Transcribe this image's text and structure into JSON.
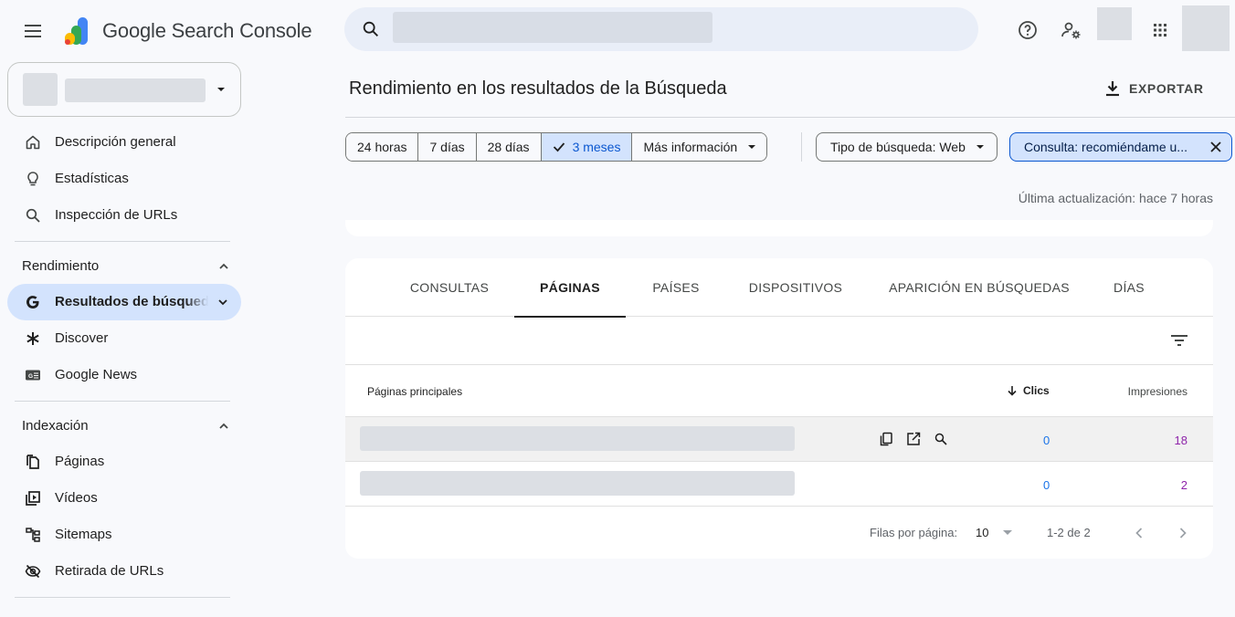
{
  "header": {
    "app_title_brand": "Google",
    "app_title_product": "Search Console",
    "search_placeholder": ""
  },
  "sidebar": {
    "overview": "Descripción general",
    "insights": "Estadísticas",
    "url_inspection": "Inspección de URLs",
    "performance_section": "Rendimiento",
    "search_results": "Resultados de búsqueda",
    "discover": "Discover",
    "google_news": "Google News",
    "indexing_section": "Indexación",
    "pages": "Páginas",
    "videos": "Vídeos",
    "sitemaps": "Sitemaps",
    "removals": "Retirada de URLs"
  },
  "main": {
    "title": "Rendimiento en los resultados de la Búsqueda",
    "export_label": "EXPORTAR",
    "date_options": [
      "24 horas",
      "7 días",
      "28 días",
      "3 meses"
    ],
    "selected_date": "3 meses",
    "more_label": "Más información",
    "search_type_chip": "Tipo de búsqueda: Web",
    "query_chip": "Consulta: recomiéndame u...",
    "last_update": "Última actualización: hace 7 horas"
  },
  "table": {
    "tabs": [
      "CONSULTAS",
      "PÁGINAS",
      "PAÍSES",
      "DISPOSITIVOS",
      "APARICIÓN EN BÚSQUEDAS",
      "DÍAS"
    ],
    "active_tab": "PÁGINAS",
    "col_pages": "Páginas principales",
    "col_clicks": "Clics",
    "col_impressions": "Impresiones",
    "rows": [
      {
        "clicks": "0",
        "impressions": "18"
      },
      {
        "clicks": "0",
        "impressions": "2"
      }
    ],
    "rows_per_page_label": "Filas por página:",
    "rows_per_page_value": "10",
    "range": "1-2 de 2"
  },
  "colors": {
    "accent_blue": "#0b57d0",
    "active_bg": "#d3e3fd",
    "clicks_color": "#1a73e8",
    "impressions_color": "#8e24aa"
  }
}
